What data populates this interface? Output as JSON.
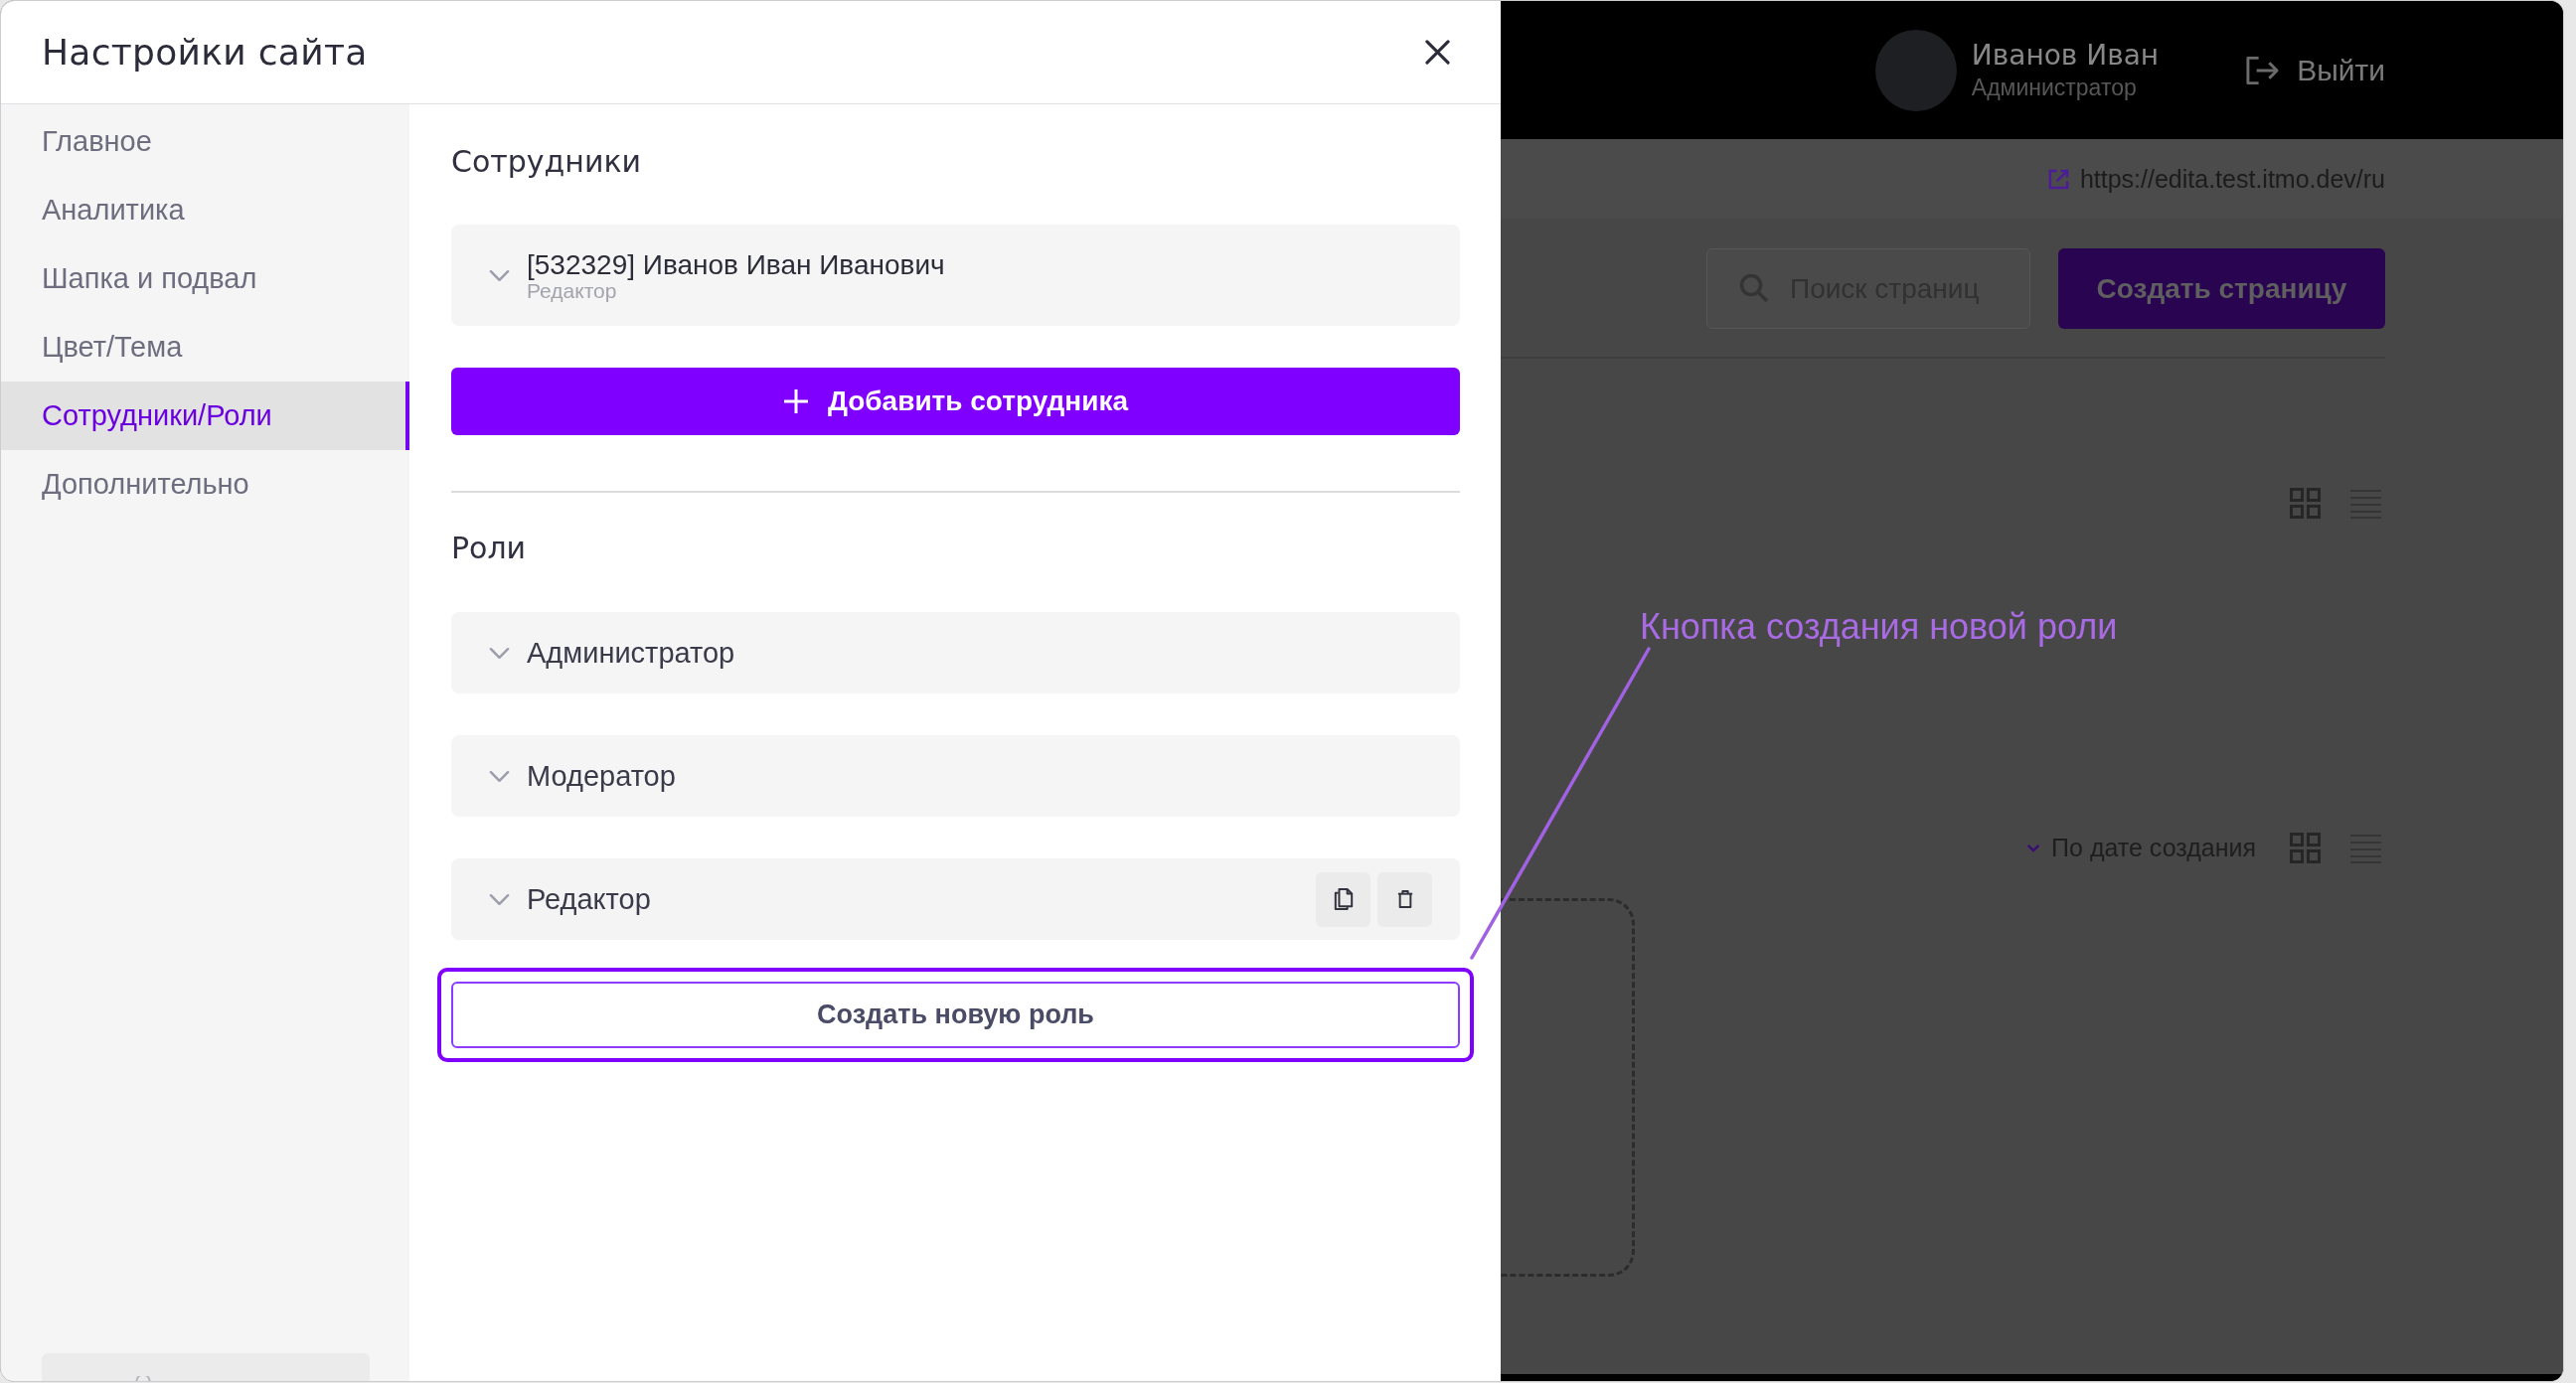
{
  "dialog": {
    "title": "Настройки сайта"
  },
  "sidebar": {
    "items": [
      {
        "label": "Главное",
        "selected": false
      },
      {
        "label": "Аналитика",
        "selected": false
      },
      {
        "label": "Шапка и подвал",
        "selected": false
      },
      {
        "label": "Цвет/Тема",
        "selected": false
      },
      {
        "label": "Сотрудники/Роли",
        "selected": true
      },
      {
        "label": "Дополнительно",
        "selected": false
      }
    ]
  },
  "employees": {
    "heading": "Сотрудники",
    "items": [
      {
        "name": "[532329] Иванов Иван Иванович",
        "role": "Редактор",
        "expanded": false
      }
    ],
    "add_button": "Добавить сотрудника"
  },
  "roles": {
    "heading": "Роли",
    "items": [
      {
        "name": "Администратор",
        "expanded": false,
        "hovered": false
      },
      {
        "name": "Модератор",
        "expanded": false,
        "hovered": false
      },
      {
        "name": "Редактор",
        "expanded": false,
        "hovered": true
      }
    ],
    "create_button": {
      "label": "Создать новую роль",
      "highlighted": true
    }
  },
  "page": {
    "user": {
      "name": "Иванов Иван",
      "role": "Администратор"
    },
    "logout": "Выйти",
    "site_link": "https://edita.test.itmo.dev/ru",
    "search": {
      "placeholder": "Поиск страниц"
    },
    "create_page_button": "Создать страницу",
    "sort": "По дате создания"
  },
  "annotation": {
    "text": "Кнопка создания новой роли"
  }
}
